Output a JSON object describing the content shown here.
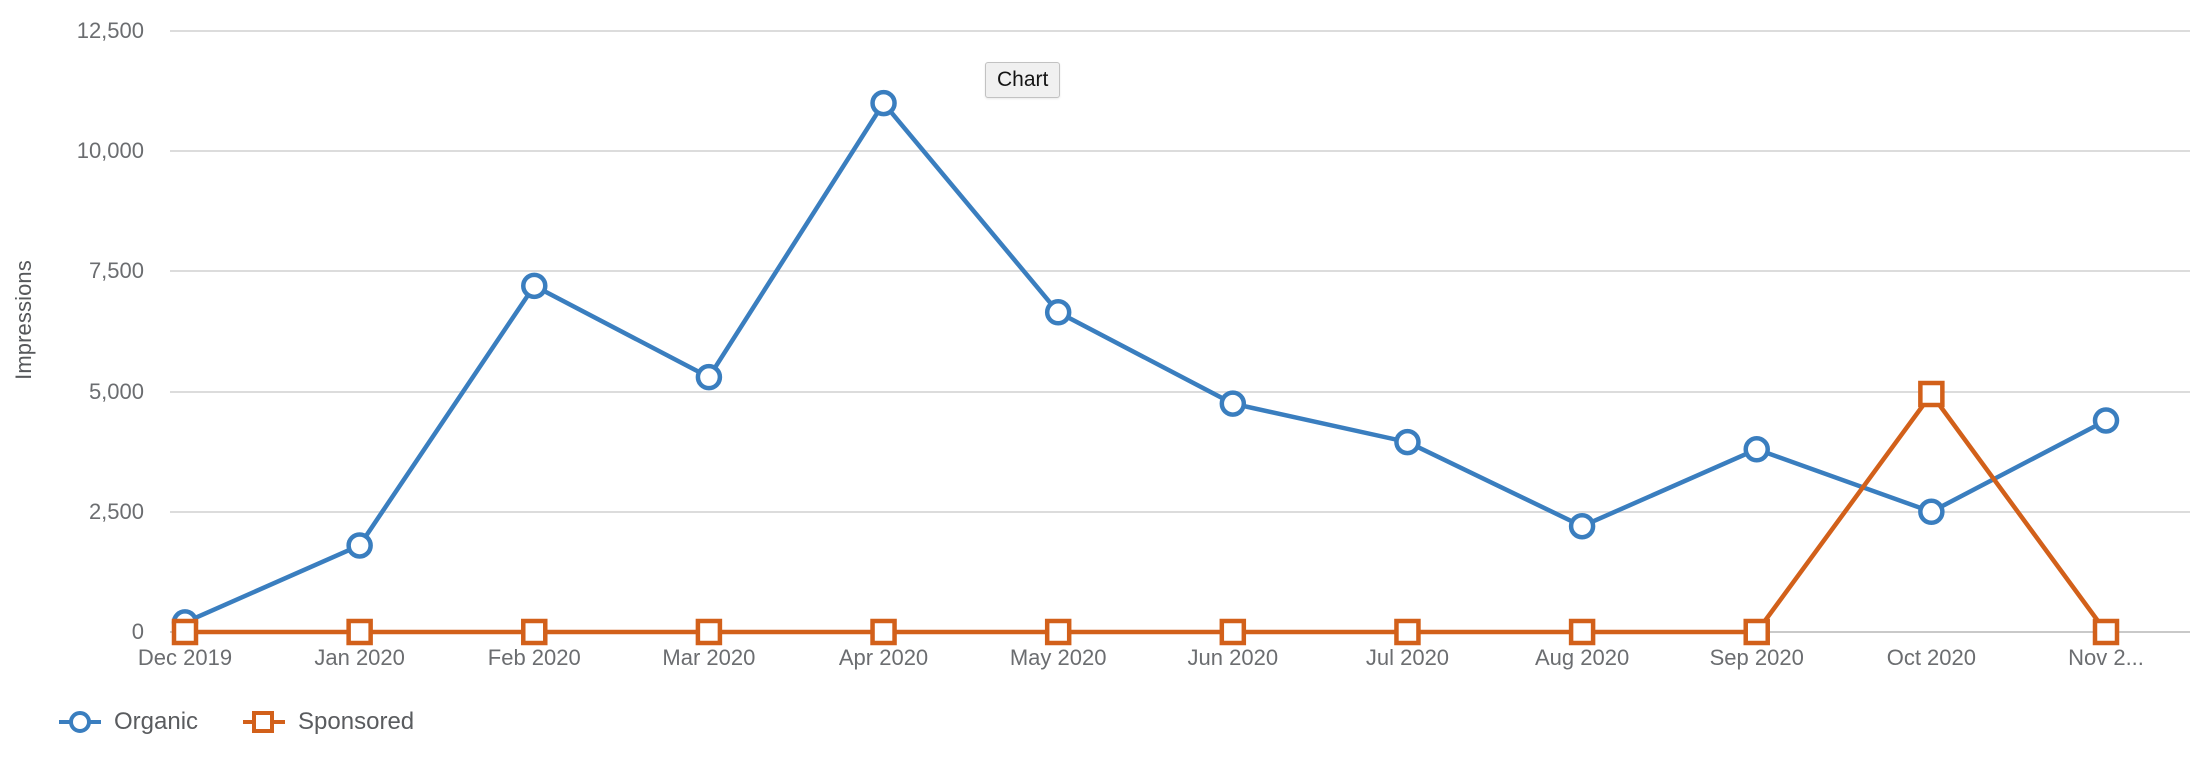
{
  "chart_data": {
    "type": "line",
    "title": "",
    "xlabel": "",
    "ylabel": "Impressions",
    "ylim": [
      0,
      12500
    ],
    "yticks": [
      0,
      2500,
      5000,
      7500,
      10000,
      12500
    ],
    "ytick_labels": [
      "0",
      "2,500",
      "5,000",
      "7,500",
      "10,000",
      "12,500"
    ],
    "grid": true,
    "legend_position": "bottom-left",
    "categories": [
      "Dec 2019",
      "Jan 2020",
      "Feb 2020",
      "Mar 2020",
      "Apr 2020",
      "May 2020",
      "Jun 2020",
      "Jul 2020",
      "Aug 2020",
      "Sep 2020",
      "Oct 2020",
      "Nov 2..."
    ],
    "series": [
      {
        "name": "Organic",
        "color": "#3a7ebf",
        "marker": "circle",
        "values": [
          200,
          1800,
          7200,
          5300,
          11000,
          6650,
          4750,
          3950,
          2200,
          3800,
          2500,
          4400
        ]
      },
      {
        "name": "Sponsored",
        "color": "#d2601a",
        "marker": "square",
        "values": [
          0,
          0,
          0,
          0,
          0,
          0,
          0,
          0,
          0,
          0,
          4950,
          0
        ]
      }
    ]
  },
  "axis": {
    "y_title": "Impressions"
  },
  "tooltip": {
    "label": "Chart"
  },
  "legend": {
    "items": [
      {
        "label": "Organic",
        "color": "#3a7ebf",
        "marker": "circle"
      },
      {
        "label": "Sponsored",
        "color": "#d2601a",
        "marker": "square"
      }
    ]
  }
}
